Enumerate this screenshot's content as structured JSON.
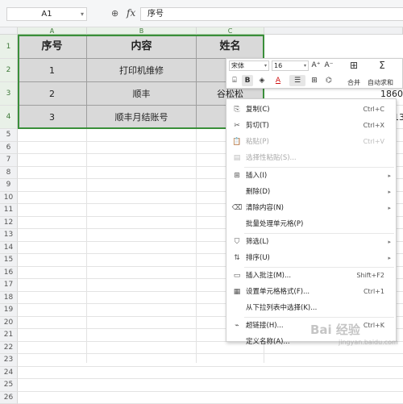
{
  "formula_bar": {
    "cell_ref": "A1",
    "zoom_icon": "zoom-icon",
    "fx_label": "fx",
    "value": "序号"
  },
  "grid": {
    "column_headers": [
      "A",
      "B",
      "C"
    ],
    "row_headers": [
      "1",
      "2",
      "3",
      "4",
      "5",
      "6",
      "7",
      "8",
      "9",
      "10",
      "11",
      "12",
      "13",
      "14",
      "15",
      "16",
      "17",
      "18",
      "19",
      "20",
      "21",
      "22",
      "23",
      "24",
      "25",
      "26"
    ],
    "header_row": [
      "序号",
      "内容",
      "姓名"
    ],
    "rows": [
      [
        "1",
        "打印机维修",
        "?"
      ],
      [
        "2",
        "顺丰",
        "谷松松"
      ],
      [
        "3",
        "顺丰月结账号",
        ""
      ]
    ],
    "overflow_d3": "1860",
    "overflow_d4": "13"
  },
  "mini_toolbar": {
    "font_name": "宋体",
    "font_size": "16",
    "grow_font": "A⁺",
    "shrink_font": "A⁻",
    "bold": "B",
    "font_color": "A",
    "merge_label": "合并",
    "autosum_label": "自动求和"
  },
  "context_menu": {
    "items": [
      {
        "icon": "copy-icon",
        "label": "复制(C)",
        "shortcut": "Ctrl+C",
        "disabled": false
      },
      {
        "icon": "cut-icon",
        "label": "剪切(T)",
        "shortcut": "Ctrl+X",
        "disabled": false
      },
      {
        "icon": "paste-icon",
        "label": "粘贴(P)",
        "shortcut": "Ctrl+V",
        "disabled": true
      },
      {
        "icon": "paste-special-icon",
        "label": "选择性粘贴(S)...",
        "shortcut": "",
        "disabled": true
      },
      {
        "icon": "insert-icon",
        "label": "插入(I)",
        "shortcut": "",
        "disabled": false,
        "submenu": true
      },
      {
        "icon": "",
        "label": "删除(D)",
        "shortcut": "",
        "disabled": false,
        "submenu": true
      },
      {
        "icon": "clear-icon",
        "label": "清除内容(N)",
        "shortcut": "",
        "disabled": false,
        "submenu": true
      },
      {
        "icon": "",
        "label": "批量处理单元格(P)",
        "shortcut": "",
        "disabled": false
      },
      {
        "icon": "filter-icon",
        "label": "筛选(L)",
        "shortcut": "",
        "disabled": false,
        "submenu": true
      },
      {
        "icon": "sort-icon",
        "label": "排序(U)",
        "shortcut": "",
        "disabled": false,
        "submenu": true
      },
      {
        "icon": "comment-icon",
        "label": "插入批注(M)...",
        "shortcut": "Shift+F2",
        "disabled": false
      },
      {
        "icon": "format-cells-icon",
        "label": "设置单元格格式(F)...",
        "shortcut": "Ctrl+1",
        "disabled": false
      },
      {
        "icon": "",
        "label": "从下拉列表中选择(K)...",
        "shortcut": "",
        "disabled": false
      },
      {
        "icon": "hyperlink-icon",
        "label": "超链接(H)...",
        "shortcut": "Ctrl+K",
        "disabled": false
      },
      {
        "icon": "",
        "label": "定义名称(A)...",
        "shortcut": "",
        "disabled": false
      }
    ]
  },
  "colors": {
    "selection": "#3a8f3a",
    "data_fill": "#d9d9d9",
    "header_highlight": "#e9f1e8"
  },
  "watermark": "Bai 经验",
  "watermark_sub": "jingyan.baidu.com"
}
